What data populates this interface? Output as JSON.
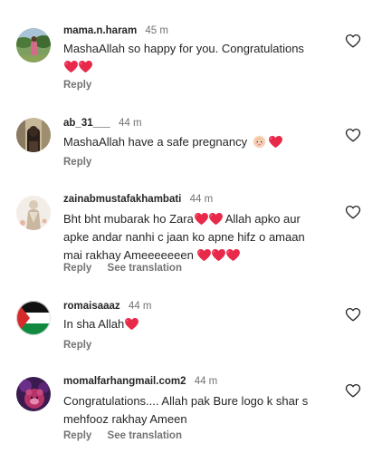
{
  "comments": [
    {
      "username": "mama.n.haram",
      "time": "45 m",
      "text_lines": [
        "MashaAllah so happy for you. Congratulations"
      ],
      "reply_label": "Reply"
    },
    {
      "username": "ab_31___",
      "time": "44 m",
      "text_lines": [
        "MashaAllah have a safe pregnancy"
      ],
      "reply_label": "Reply"
    },
    {
      "username": "zainabmustafakhambati",
      "time": "44 m",
      "text_lines": [
        "Bht bht mubarak ho Zara",
        "Allah apko aur",
        "apke andar nanhi c jaan ko apne hifz o amaan",
        "mai rakhay Ameeeeeeen"
      ],
      "reply_label": "Reply",
      "translation_label": "See translation"
    },
    {
      "username": "romaisaaaz",
      "time": "44 m",
      "text_lines": [
        "In sha Allah"
      ],
      "reply_label": "Reply"
    },
    {
      "username": "momalfarhangmail.com2",
      "time": "44 m",
      "text_lines": [
        "Congratulations.... Allah pak Bure logo k shar s",
        "mehfooz rakhay Ameen"
      ],
      "reply_label": "Reply",
      "translation_label": "See translation"
    }
  ],
  "icons": {
    "like": "heart-outline-icon",
    "emoji_heart": "red-heart-emoji",
    "emoji_baby": "baby-emoji"
  },
  "colors": {
    "text": "#262626",
    "secondary": "#737373",
    "heart_red": "#e8294a"
  }
}
